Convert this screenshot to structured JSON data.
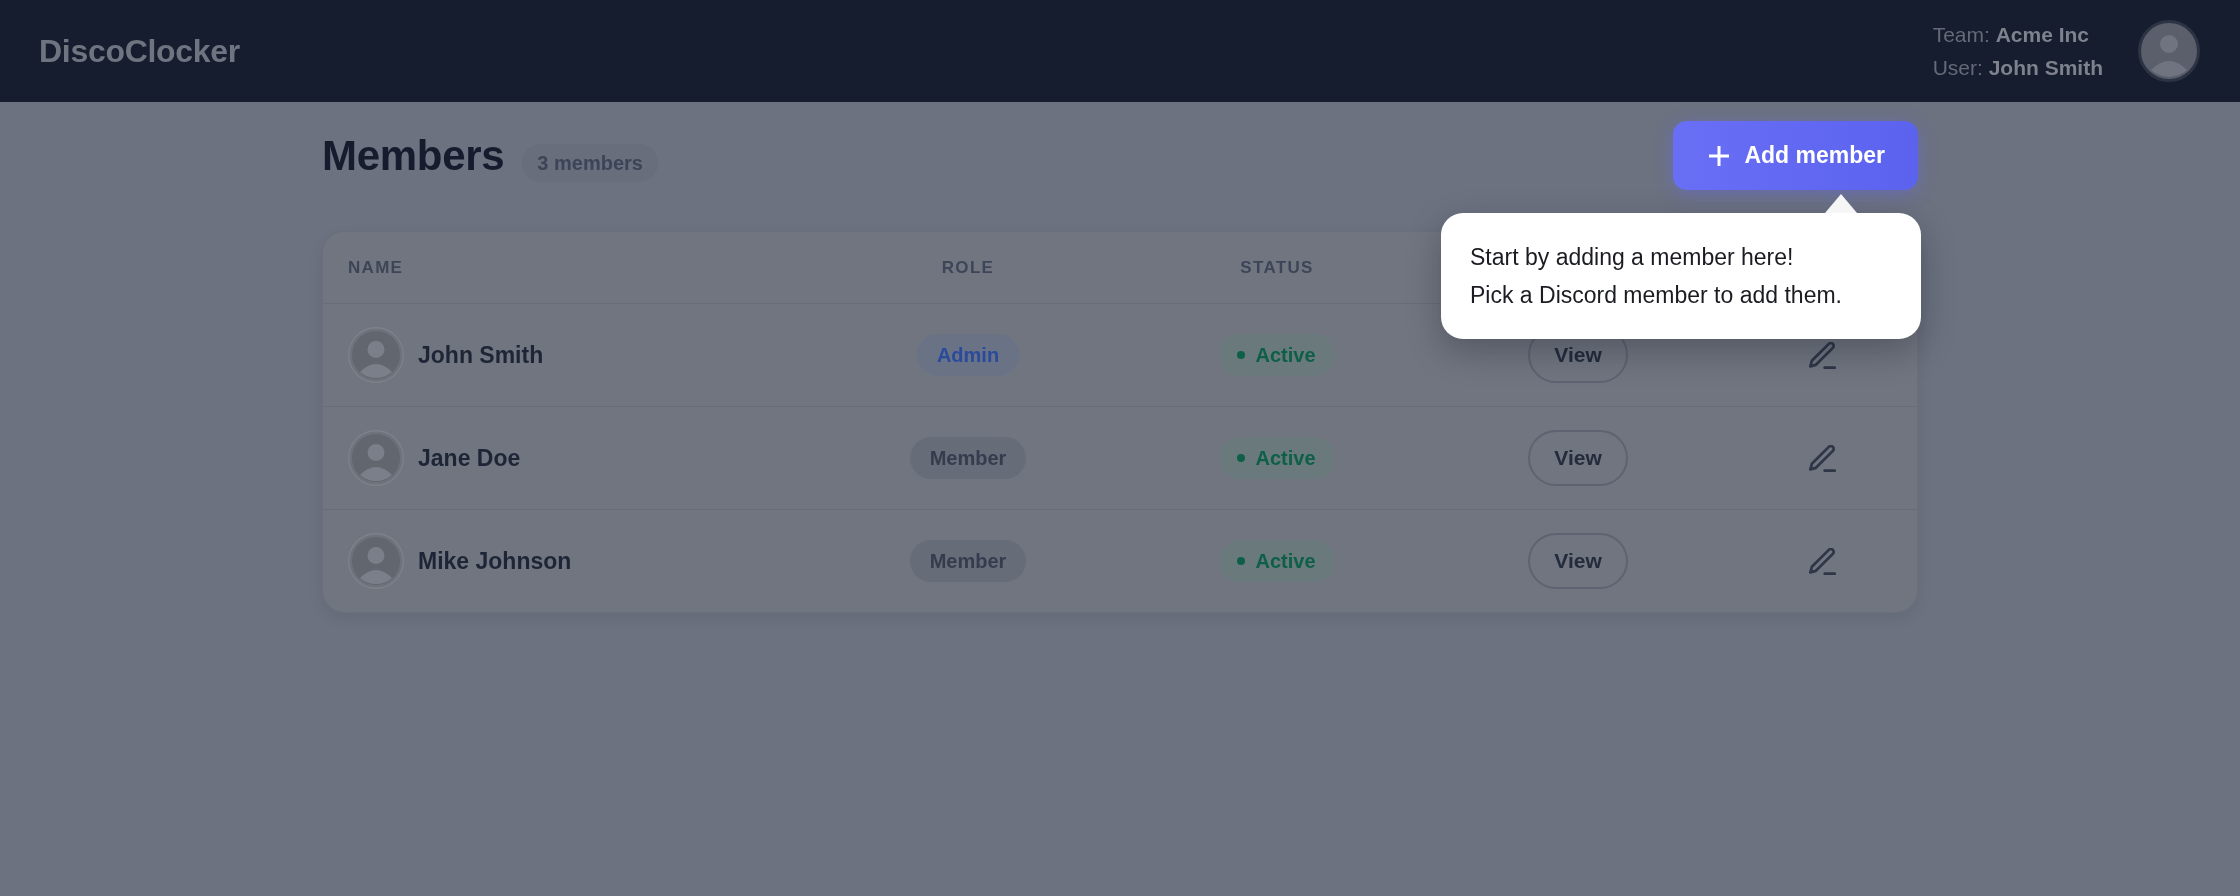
{
  "header": {
    "logo": "DiscoClocker",
    "team": "Team: **Acme Inc**",
    "user": "User: **John Smith**"
  },
  "page": {
    "title": "Members",
    "count": "3 members",
    "add_button": "Add member"
  },
  "table": {
    "columns": [
      "NAME",
      "ROLE",
      "STATUS"
    ],
    "rows": [
      {
        "name": "John Smith",
        "role": {
          "label": "Admin",
          "kind": "admin"
        },
        "status": {
          "label": "Active",
          "kind": "active"
        },
        "action": "View"
      },
      {
        "name": "Jane Doe",
        "role": {
          "label": "Member",
          "kind": "member"
        },
        "status": {
          "label": "Active",
          "kind": "active"
        },
        "action": "View"
      },
      {
        "name": "Mike Johnson",
        "role": {
          "label": "Member",
          "kind": "member"
        },
        "status": {
          "label": "Active",
          "kind": "active"
        },
        "action": "View"
      }
    ]
  },
  "tooltip": {
    "lines": [
      "Start by adding a member here!",
      "Pick a Discord member to add them."
    ]
  }
}
